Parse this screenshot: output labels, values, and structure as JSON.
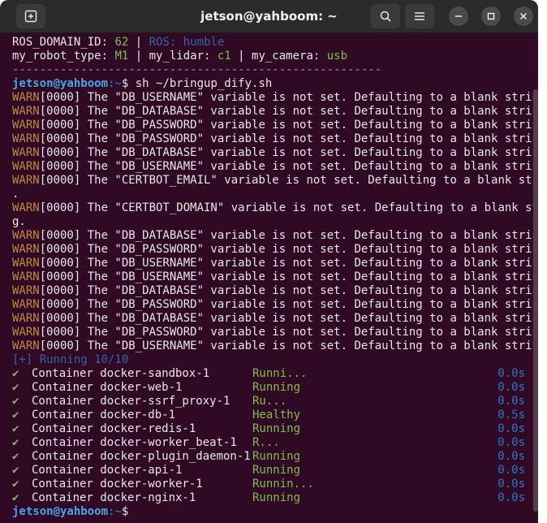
{
  "window": {
    "title": "jetson@yahboom: ~"
  },
  "env": {
    "line1": {
      "k1": "ROS_DOMAIN_ID: ",
      "v1": "62",
      "sep": " | ",
      "k2": "ROS: humble"
    },
    "line2": {
      "k1": "my_robot_type: ",
      "v1": "M1",
      "s1": " | my_lidar: ",
      "v2": "c1",
      "s2": " | my_camera: ",
      "v3": "usb"
    },
    "rule": "------------------------------------------------------"
  },
  "prompt": {
    "user": "jetson@yahboom",
    "path": ":~",
    "sym": "$ ",
    "cmd": "sh ~/bringup_dify.sh"
  },
  "warns": [
    {
      "tag": "WARN",
      "rest": "[0000] The \"DB_USERNAME\" variable is not set. Defaulting to a blank string."
    },
    {
      "tag": "WARN",
      "rest": "[0000] The \"DB_DATABASE\" variable is not set. Defaulting to a blank string."
    },
    {
      "tag": "WARN",
      "rest": "[0000] The \"DB_PASSWORD\" variable is not set. Defaulting to a blank string."
    },
    {
      "tag": "WARN",
      "rest": "[0000] The \"DB_PASSWORD\" variable is not set. Defaulting to a blank string."
    },
    {
      "tag": "WARN",
      "rest": "[0000] The \"DB_DATABASE\" variable is not set. Defaulting to a blank string."
    },
    {
      "tag": "WARN",
      "rest": "[0000] The \"DB_USERNAME\" variable is not set. Defaulting to a blank string."
    },
    {
      "tag": "WARN",
      "rest": "[0000] The \"CERTBOT_EMAIL\" variable is not set. Defaulting to a blank string"
    },
    {
      "tag": "",
      "rest": "."
    },
    {
      "tag": "WARN",
      "rest": "[0000] The \"CERTBOT_DOMAIN\" variable is not set. Defaulting to a blank strin"
    },
    {
      "tag": "",
      "rest": "g."
    },
    {
      "tag": "WARN",
      "rest": "[0000] The \"DB_DATABASE\" variable is not set. Defaulting to a blank string."
    },
    {
      "tag": "WARN",
      "rest": "[0000] The \"DB_PASSWORD\" variable is not set. Defaulting to a blank string."
    },
    {
      "tag": "WARN",
      "rest": "[0000] The \"DB_USERNAME\" variable is not set. Defaulting to a blank string."
    },
    {
      "tag": "WARN",
      "rest": "[0000] The \"DB_USERNAME\" variable is not set. Defaulting to a blank string."
    },
    {
      "tag": "WARN",
      "rest": "[0000] The \"DB_DATABASE\" variable is not set. Defaulting to a blank string."
    },
    {
      "tag": "WARN",
      "rest": "[0000] The \"DB_PASSWORD\" variable is not set. Defaulting to a blank string."
    },
    {
      "tag": "WARN",
      "rest": "[0000] The \"DB_DATABASE\" variable is not set. Defaulting to a blank string."
    },
    {
      "tag": "WARN",
      "rest": "[0000] The \"DB_PASSWORD\" variable is not set. Defaulting to a blank string."
    },
    {
      "tag": "WARN",
      "rest": "[0000] The \"DB_USERNAME\" variable is not set. Defaulting to a blank string."
    }
  ],
  "running": "[+] Running 10/10",
  "containers": [
    {
      "check": "✔",
      "name": "Container docker-sandbox-1",
      "status": "Runni...",
      "time": "0.0s"
    },
    {
      "check": "✔",
      "name": "Container docker-web-1",
      "status": "Running",
      "time": "0.0s"
    },
    {
      "check": "✔",
      "name": "Container docker-ssrf_proxy-1",
      "status": "Ru...",
      "time": "0.0s"
    },
    {
      "check": "✔",
      "name": "Container docker-db-1",
      "status": "Healthy",
      "time": "0.5s"
    },
    {
      "check": "✔",
      "name": "Container docker-redis-1",
      "status": "Running",
      "time": "0.0s"
    },
    {
      "check": "✔",
      "name": "Container docker-worker_beat-1",
      "status": "R...",
      "time": "0.0s"
    },
    {
      "check": "✔",
      "name": "Container docker-plugin_daemon-1",
      "status": "Running",
      "time": "0.0s"
    },
    {
      "check": "✔",
      "name": "Container docker-api-1",
      "status": "Running",
      "time": "0.0s"
    },
    {
      "check": "✔",
      "name": "Container docker-worker-1",
      "status": "Runnin...",
      "time": "0.0s"
    },
    {
      "check": "✔",
      "name": "Container docker-nginx-1",
      "status": "Running",
      "time": "0.0s"
    }
  ],
  "final_prompt": {
    "user": "jetson@yahboom",
    "path": ":~",
    "sym": "$"
  },
  "icons": {
    "new_tab": "new-tab-icon",
    "search": "search-icon",
    "menu": "hamburger-menu-icon",
    "minimize": "minimize-icon",
    "maximize": "maximize-icon",
    "close": "close-icon"
  }
}
